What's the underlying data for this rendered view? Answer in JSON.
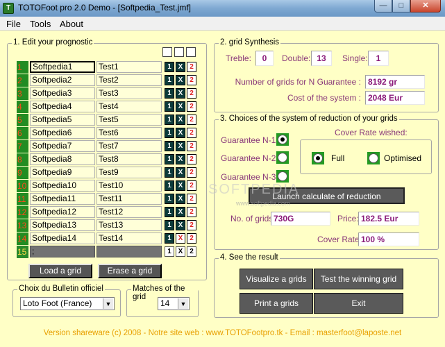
{
  "window": {
    "title": "TOTOFoot pro 2.0 Demo - [Softpedia_Test.jmf]",
    "app_icon": "T"
  },
  "menu": [
    "File",
    "Tools",
    "About"
  ],
  "prognostic": {
    "legend": "1. Edit your prognostic",
    "rows": [
      {
        "num": "1",
        "team1": "Softpedia1",
        "team2": "Test1",
        "b1": "1",
        "bx": "X",
        "b2": "2"
      },
      {
        "num": "2",
        "team1": "Softpedia2",
        "team2": "Test2",
        "b1": "1",
        "bx": "X",
        "b2": "2"
      },
      {
        "num": "3",
        "team1": "Softpedia3",
        "team2": "Test3",
        "b1": "1",
        "bx": "X",
        "b2": "2"
      },
      {
        "num": "4",
        "team1": "Softpedia4",
        "team2": "Test4",
        "b1": "1",
        "bx": "X",
        "b2": "2"
      },
      {
        "num": "5",
        "team1": "Softpedia5",
        "team2": "Test5",
        "b1": "1",
        "bx": "X",
        "b2": "2"
      },
      {
        "num": "6",
        "team1": "Softpedia6",
        "team2": "Test6",
        "b1": "1",
        "bx": "X",
        "b2": "2"
      },
      {
        "num": "7",
        "team1": "Softpedia7",
        "team2": "Test7",
        "b1": "1",
        "bx": "X",
        "b2": "2"
      },
      {
        "num": "8",
        "team1": "Softpedia8",
        "team2": "Test8",
        "b1": "1",
        "bx": "X",
        "b2": "2"
      },
      {
        "num": "9",
        "team1": "Softpedia9",
        "team2": "Test9",
        "b1": "1",
        "bx": "X",
        "b2": "2"
      },
      {
        "num": "10",
        "team1": "Softpedia10",
        "team2": "Test10",
        "b1": "1",
        "bx": "X",
        "b2": "2"
      },
      {
        "num": "11",
        "team1": "Softpedia11",
        "team2": "Test11",
        "b1": "1",
        "bx": "X",
        "b2": "2"
      },
      {
        "num": "12",
        "team1": "Softpedia12",
        "team2": "Test12",
        "b1": "1",
        "bx": "X",
        "b2": "2"
      },
      {
        "num": "13",
        "team1": "Softpedia13",
        "team2": "Test13",
        "b1": "1",
        "bx": "X",
        "b2": "2"
      },
      {
        "num": "14",
        "team1": "Softpedia14",
        "team2": "Test14",
        "b1": "1",
        "bx": "X",
        "b2": "2"
      },
      {
        "num": "15",
        "team1": ";",
        "team2": "",
        "b1": "1",
        "bx": "X",
        "b2": "2"
      }
    ],
    "load_label": "Load a grid",
    "erase_label": "Erase a grid",
    "bulletin_legend": "Choix du Bulletin officiel",
    "bulletin_value": "Loto Foot (France)",
    "matches_legend": "Matches of the grid",
    "matches_value": "14"
  },
  "synthesis": {
    "legend": "2. grid Synthesis",
    "treble_label": "Treble:",
    "treble_value": "0",
    "double_label": "Double:",
    "double_value": "13",
    "single_label": "Single:",
    "single_value": "1",
    "grids_label": "Number of grids for N Guarantee :",
    "grids_value": "8192 gr",
    "cost_label": "Cost of the system :",
    "cost_value": "2048 Eur"
  },
  "reduction": {
    "legend": "3. Choices of the system of reduction of your grids",
    "guarantee_options": [
      "Guarantee N-1",
      "Guarantee N-2",
      "Guarantee N-3"
    ],
    "guarantee_selected": 0,
    "cover_rate_title": "Cover Rate wished:",
    "full_label": "Full",
    "optimised_label": "Optimised",
    "launch_label": "Launch calculate of reduction",
    "no_grids_label": "No. of grids:",
    "no_grids_value": "730G",
    "price_label": "Price:",
    "price_value": "182.5 Eur",
    "cover_rate_label": "Cover Rate:",
    "cover_rate_value": "100 %"
  },
  "result": {
    "legend": "4. See the result",
    "visualize_label": "Visualize a grids",
    "test_label": "Test the winning grid",
    "print_label": "Print a grids",
    "exit_label": "Exit"
  },
  "footer": "Version shareware (c) 2008   -   Notre site web : www.TOTOFootpro.tk   -   Email : masterfoot@laposte.net",
  "watermark": "SOFTPEDIA",
  "watermark_url": "www.softpedia.com",
  "colors": {
    "client_bg": "#ffffc6",
    "row_num_bg": "#228c22",
    "value_text": "#8a1a7a",
    "footer_text": "#e8a000"
  }
}
